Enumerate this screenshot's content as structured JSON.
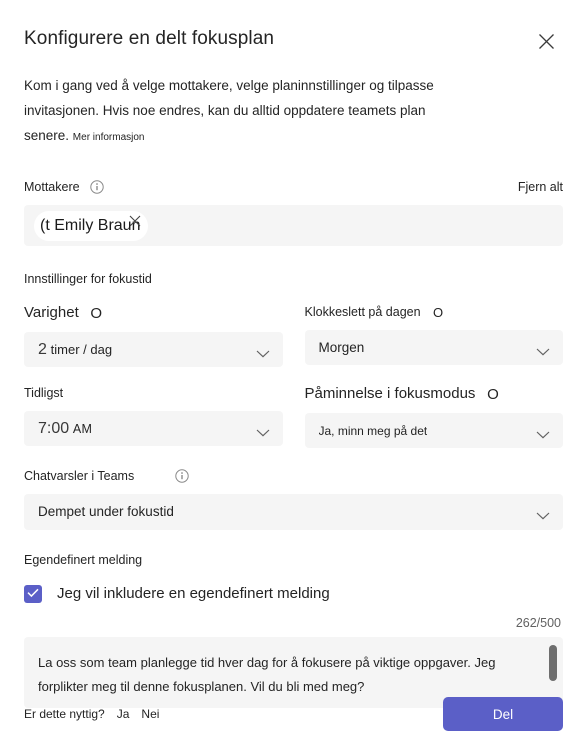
{
  "dialog": {
    "title": "Konfigurere en delt fokusplan",
    "close_icon": "close-icon",
    "description": "Kom i gang ved å velge mottakere, velge planinnstillinger og tilpasse invitasjonen. Hvis noe endres, kan du alltid oppdatere teamets plan senere.",
    "description_link": "Mer informasjon"
  },
  "recipients": {
    "label": "Mottakere",
    "info_icon": "info-icon",
    "clear_all_label": "Fjern alt",
    "chips": [
      {
        "text": "(t Emily Braun",
        "remove_icon": "close-icon"
      }
    ]
  },
  "focus_settings": {
    "caption": "Innstillinger for fokustid",
    "fields": [
      {
        "label": "Varighet",
        "info_icon": "info-icon",
        "value_lead": "2",
        "value_tail": "timer / dag",
        "chevron_icon": "chevron-down-icon"
      },
      {
        "label": "Klokkeslett på dagen",
        "info_icon": "info-icon",
        "value": "Morgen",
        "chevron_icon": "chevron-down-icon"
      },
      {
        "label": "Tidligst",
        "info_icon": "",
        "value_lead": "7:00",
        "value_tail": "AM",
        "chevron_icon": "chevron-down-icon"
      },
      {
        "label": "Påminnelse i fokusmodus",
        "info_icon": "info-icon",
        "value": "Ja, minn meg på det",
        "chevron_icon": "chevron-down-icon"
      }
    ]
  },
  "chat_notifications": {
    "label": "Chatvarsler i Teams",
    "info_icon": "info-icon",
    "value": "Dempet under fokustid",
    "chevron_icon": "chevron-down-icon"
  },
  "custom_message": {
    "caption": "Egendefinert melding",
    "checkbox_label": "Jeg vil inkludere en egendefinert melding",
    "checkbox_checked": true,
    "check_icon": "checkmark-icon",
    "char_count": "262/500",
    "text": "La oss som team planlegge tid hver dag for å fokusere på viktige oppgaver. Jeg forplikter meg til denne fokusplanen. Vil du bli med meg?"
  },
  "footer": {
    "feedback_question": "Er dette nyttig?",
    "feedback_yes": "Ja",
    "feedback_no": "Nei",
    "share_label": "Del"
  },
  "colors": {
    "accent": "#5b5fc7",
    "field_bg": "#f5f5f5",
    "text": "#242424"
  }
}
